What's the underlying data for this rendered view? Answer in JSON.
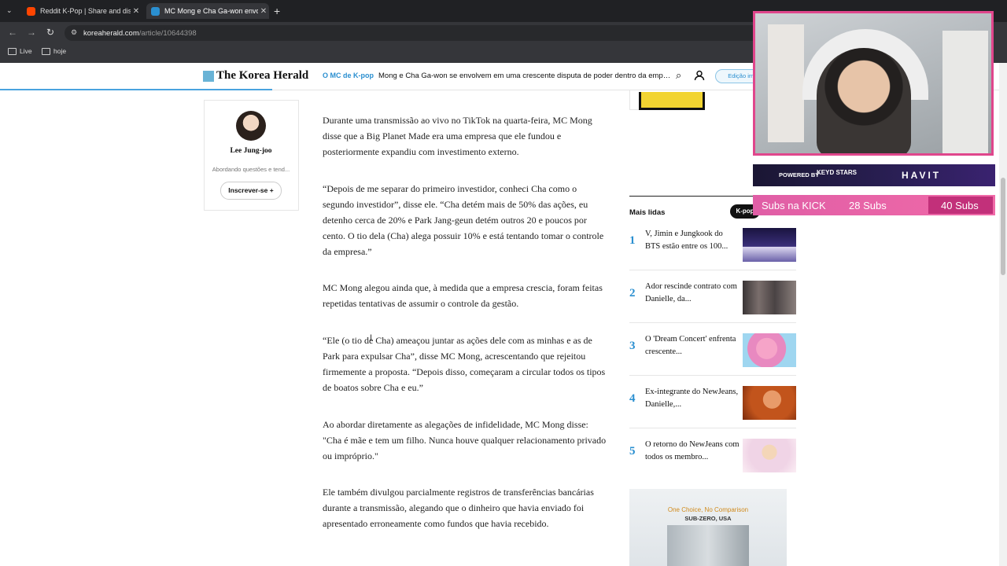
{
  "browser": {
    "tabs": [
      {
        "title": "Reddit K-Pop | Share and discover",
        "icon": "reddit-icon"
      },
      {
        "title": "MC Mong e Cha Ga-won envolv",
        "icon": "korea-herald-icon"
      }
    ],
    "url_domain": "koreaherald.com",
    "url_path": "/article/10644398",
    "bookmarks": [
      "Live",
      "hoje"
    ]
  },
  "header": {
    "logo": "The Korea Herald",
    "section": "O MC de K-pop",
    "title": "Mong e Cha Ga-won se envolvem em uma crescente disputa de poder dentro da empres...",
    "edition": "Edição impr"
  },
  "author": {
    "name": "Lee Jung-joo",
    "desc": "Abordando questões e tend...",
    "subscribe": "Inscrever-se +"
  },
  "article": {
    "paragraphs": [
      "Durante uma transmissão ao vivo no TikTok na quarta-feira, MC Mong disse que a Big Planet Made era uma empresa que ele fundou e posteriormente expandiu com investimento externo.",
      "“Depois de me separar do primeiro investidor, conheci Cha como o segundo investidor”, disse ele. “Cha detém mais de 50% das ações, eu detenho cerca de 20% e Park Jang-geun detém outros 20 e poucos por cento. O tio dela (Cha) alega possuir 10% e está tentando tomar o controle da empresa.”",
      "MC Mong alegou ainda que, à medida que a empresa crescia, foram feitas repetidas tentativas de assumir o controle da gestão.",
      "“Ele (o tio de Cha) ameaçou juntar as ações dele com as minhas e as de Park para expulsar Cha”, disse MC Mong, acrescentando que rejeitou firmemente a proposta. “Depois disso, começaram a circular todos os tipos de boatos sobre Cha e eu.”",
      "Ao abordar diretamente as alegações de infidelidade, MC Mong disse: \"Cha é mãe e tem um filho. Nunca houve qualquer relacionamento privado ou impróprio.\"",
      "Ele também divulgou parcialmente registros de transferências bancárias durante a transmissão, alegando que o dinheiro que havia enviado foi apresentado erroneamente como fundos que havia recebido."
    ]
  },
  "sidebar": {
    "most_read": "Mais lidas",
    "filter": "K-pop",
    "items": [
      {
        "rank": "1",
        "title": "V, Jimin e Jungkook do BTS estão entre os 100..."
      },
      {
        "rank": "2",
        "title": "Ador rescinde contrato com Danielle, da..."
      },
      {
        "rank": "3",
        "title": "O 'Dream Concert' enfrenta crescente..."
      },
      {
        "rank": "4",
        "title": "Ex-integrante do NewJeans, Danielle,..."
      },
      {
        "rank": "5",
        "title": "O retorno do NewJeans com todos os membro..."
      }
    ],
    "ad_line1": "One Choice, No Comparison",
    "ad_line2": "SUB-ZERO, USA"
  },
  "stream": {
    "powered_by": "POWERED BY",
    "sponsor": "KEYD STARS",
    "brand": "HAVIT",
    "kick_label": "Subs na KICK",
    "kick_current": "28 Subs",
    "kick_goal": "40 Subs",
    "kick_progress": 0.7
  },
  "colors": {
    "accent": "#2a8fd0",
    "stream_border": "#e0468c",
    "browser_dark": "#202124"
  }
}
